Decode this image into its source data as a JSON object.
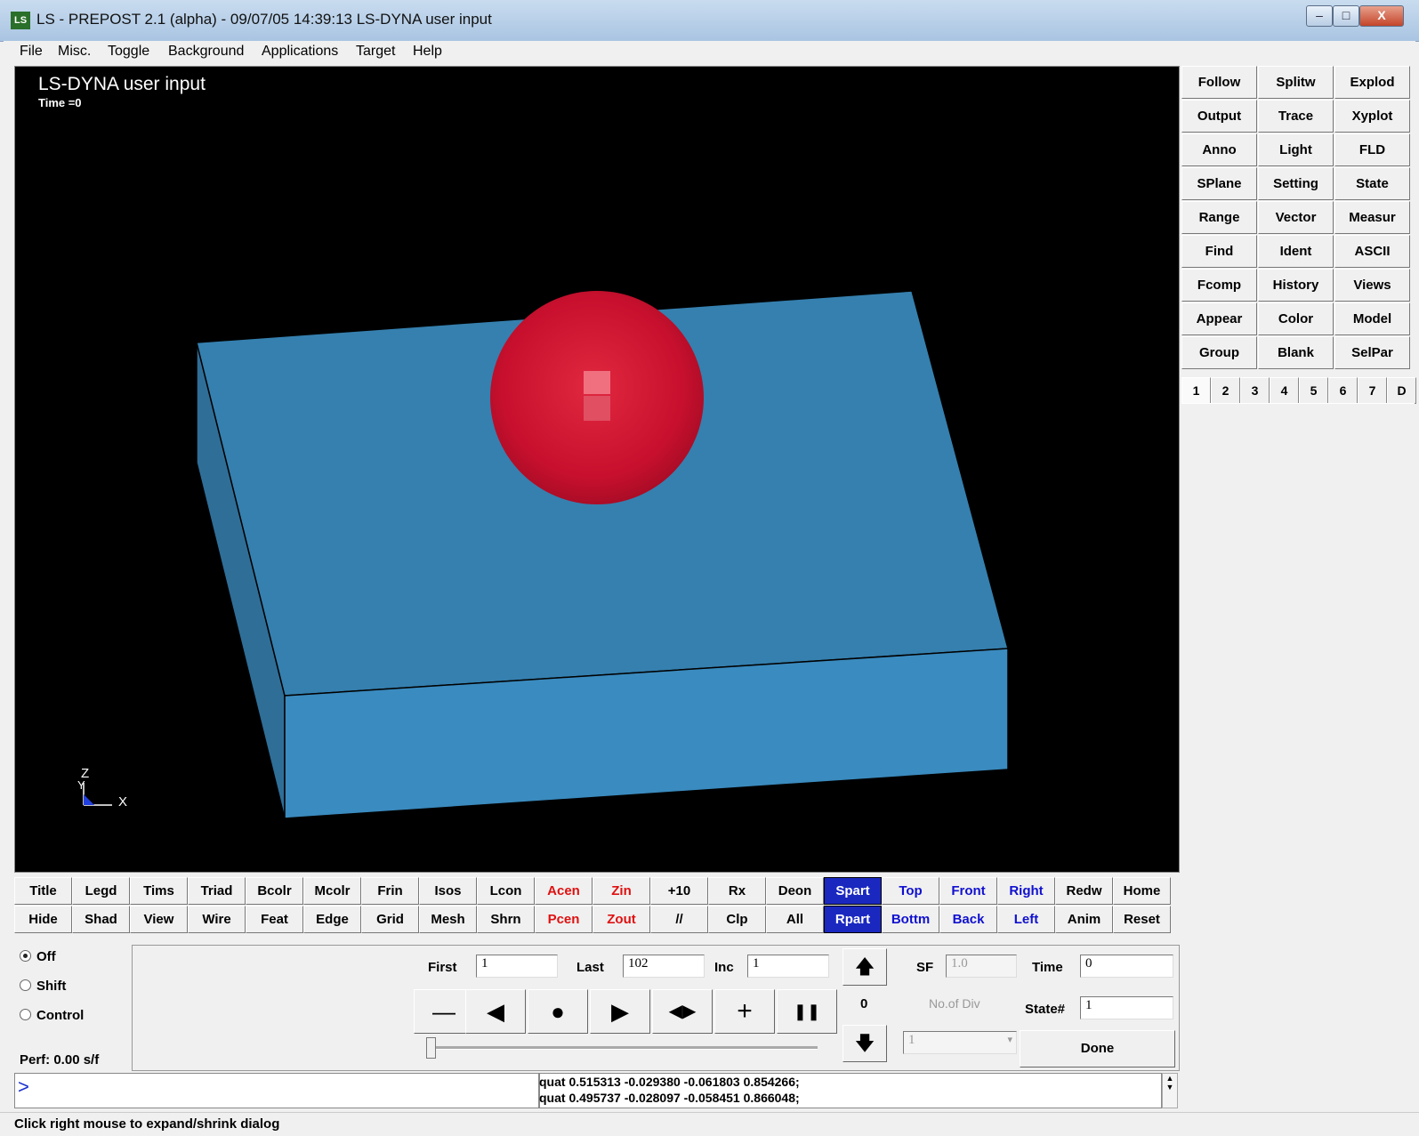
{
  "window": {
    "title": "LS - PREPOST 2.1 (alpha) - 09/07/05 14:39:13   LS-DYNA user input",
    "icon_label": "LS",
    "min_glyph": "–",
    "max_glyph": "□",
    "close_glyph": "X"
  },
  "menu": [
    "File",
    "Misc.",
    "Toggle",
    "Background",
    "Applications",
    "Target",
    "Help"
  ],
  "viewport": {
    "title": "LS-DYNA user input",
    "time_label": "Time =0",
    "triad_z": "Z",
    "triad_y": "Y",
    "triad_x": "X",
    "colors": {
      "background": "#000000",
      "plate": "#3a8bbf",
      "sphere": "#c8102e"
    }
  },
  "right_panel": {
    "buttons": [
      [
        "Follow",
        "Splitw",
        "Explod"
      ],
      [
        "Output",
        "Trace",
        "Xyplot"
      ],
      [
        "Anno",
        "Light",
        "FLD"
      ],
      [
        "SPlane",
        "Setting",
        "State"
      ],
      [
        "Range",
        "Vector",
        "Measur"
      ],
      [
        "Find",
        "Ident",
        "ASCII"
      ],
      [
        "Fcomp",
        "History",
        "Views"
      ],
      [
        "Appear",
        "Color",
        "Model"
      ],
      [
        "Group",
        "Blank",
        "SelPar"
      ]
    ],
    "tabs": [
      "1",
      "2",
      "3",
      "4",
      "5",
      "6",
      "7",
      "D"
    ]
  },
  "bottom_buttons": {
    "row1": [
      "Title",
      "Legd",
      "Tims",
      "Triad",
      "Bcolr",
      "Mcolr",
      "Frin",
      "Isos",
      "Lcon",
      "Acen",
      "Zin",
      "+10",
      "Rx",
      "Deon",
      "Spart",
      "Top",
      "Front",
      "Right",
      "Redw",
      "Home"
    ],
    "row2": [
      "Hide",
      "Shad",
      "View",
      "Wire",
      "Feat",
      "Edge",
      "Grid",
      "Mesh",
      "Shrn",
      "Pcen",
      "Zout",
      "//",
      "Clp",
      "All",
      "Rpart",
      "Bottm",
      "Back",
      "Left",
      "Anim",
      "Reset"
    ]
  },
  "modes": {
    "off": "Off",
    "shift": "Shift",
    "control": "Control",
    "selected": "Off"
  },
  "perf": "Perf:  0.00 s/f",
  "animation": {
    "first_label": "First",
    "first_value": "1",
    "last_label": "Last",
    "last_value": "102",
    "inc_label": "Inc",
    "inc_value": "1",
    "counter": "0",
    "sf_label": "SF",
    "sf_value": "1.0",
    "time_label": "Time",
    "time_value": "0",
    "ndiv_label": "No.of Div",
    "ndiv_value": "1",
    "state_label": "State#",
    "state_value": "1",
    "done_label": "Done",
    "buttons": [
      "—",
      "◀",
      "●",
      "▶",
      "◀▶",
      "+",
      "❚❚"
    ],
    "up_glyph": "🡅",
    "down_glyph": "🡇"
  },
  "command": {
    "prompt": ">",
    "log": [
      "quat 0.515313 -0.029380 -0.061803 0.854266;",
      "quat 0.495737 -0.028097 -0.058451 0.866048;"
    ]
  },
  "status": "Click right mouse to expand/shrink dialog"
}
